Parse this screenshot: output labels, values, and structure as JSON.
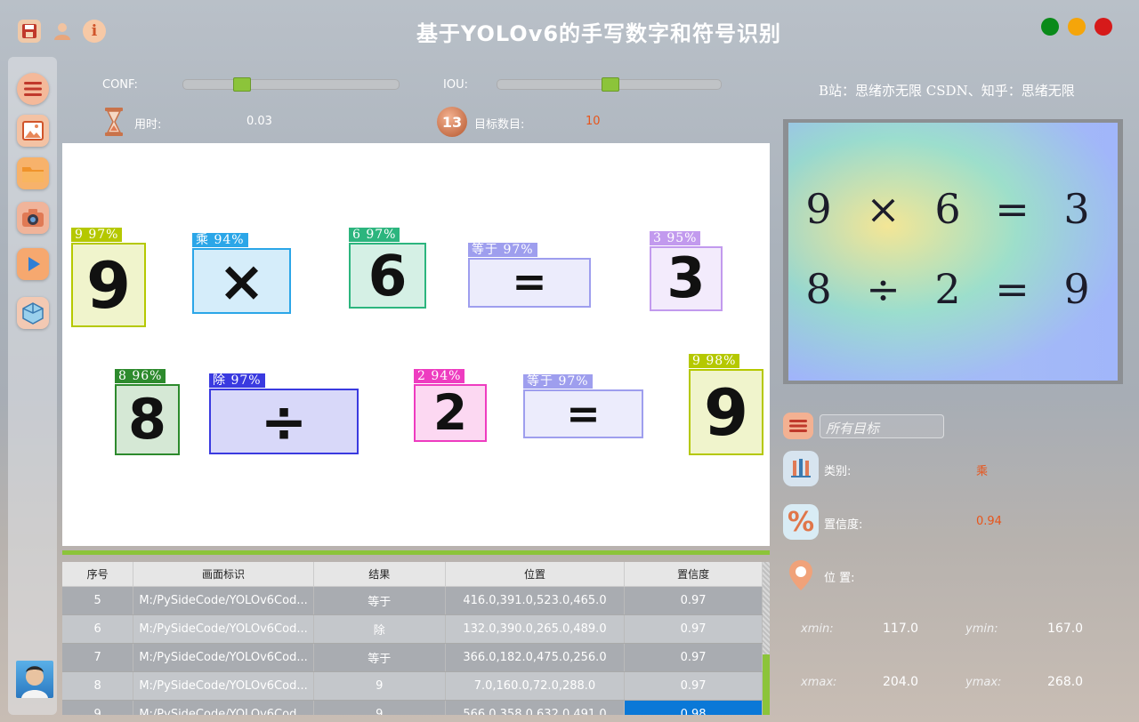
{
  "app": {
    "title": "基于YOLOv6的手写数字和符号识别"
  },
  "toolbar": {
    "icons": [
      "save-icon",
      "user-icon",
      "info-icon"
    ]
  },
  "window_controls": {
    "colors": [
      "#0a8a1a",
      "#f5a50a",
      "#d61a1a"
    ]
  },
  "sidebar": {
    "items": [
      "menu-icon",
      "image-icon",
      "folder-icon",
      "camera-icon",
      "video-icon",
      "model-icon"
    ]
  },
  "controls": {
    "conf_label": "CONF:",
    "conf_value": 0.25,
    "iou_label": "IOU:",
    "iou_value": 0.5,
    "time_label": "用时:",
    "time_value": "0.03",
    "count_label": "目标数目:",
    "count_value": "10",
    "count_badge": "13"
  },
  "credits": "B站：思绪亦无限  CSDN、知乎：思绪无限",
  "detections": [
    {
      "label": "9  97%",
      "glyph": "9",
      "color": "#b5c800"
    },
    {
      "label": "乘  94%",
      "glyph": "×",
      "color": "#2ba6e8"
    },
    {
      "label": "6  97%",
      "glyph": "6",
      "color": "#2cb57e"
    },
    {
      "label": "等于  97%",
      "glyph": "=",
      "color": "#9e9eee"
    },
    {
      "label": "3  95%",
      "glyph": "3",
      "color": "#c29aee"
    },
    {
      "label": "8  96%",
      "glyph": "8",
      "color": "#2d8a2d"
    },
    {
      "label": "除  97%",
      "glyph": "÷",
      "color": "#3a3ae0"
    },
    {
      "label": "2  94%",
      "glyph": "2",
      "color": "#ee3cc0"
    },
    {
      "label": "等于  97%",
      "glyph": "=",
      "color": "#9e9eee"
    },
    {
      "label": "9  98%",
      "glyph": "9",
      "color": "#b5c800"
    }
  ],
  "table": {
    "headers": [
      "序号",
      "画面标识",
      "结果",
      "位置",
      "置信度"
    ],
    "rows": [
      [
        "5",
        "M:/PySideCode/YOLOv6Cod...",
        "等于",
        "416.0,391.0,523.0,465.0",
        "0.97"
      ],
      [
        "6",
        "M:/PySideCode/YOLOv6Cod...",
        "除",
        "132.0,390.0,265.0,489.0",
        "0.97"
      ],
      [
        "7",
        "M:/PySideCode/YOLOv6Cod...",
        "等于",
        "366.0,182.0,475.0,256.0",
        "0.97"
      ],
      [
        "8",
        "M:/PySideCode/YOLOv6Cod...",
        "9",
        "7.0,160.0,72.0,288.0",
        "0.97"
      ],
      [
        "9",
        "M:/PySideCode/YOLOv6Cod...",
        "9",
        "566.0,358.0,632.0,491.0",
        "0.98"
      ]
    ]
  },
  "preview": {
    "line1": "9 × 6 = 3",
    "line2": "8 ÷ 2 = 9"
  },
  "target_select": {
    "placeholder": "所有目标"
  },
  "details": {
    "class_label": "类别:",
    "class_value": "乘",
    "conf_label": "置信度:",
    "conf_value": "0.94",
    "pos_label": "位 置:",
    "xmin_label": "xmin:",
    "xmin_value": "117.0",
    "ymin_label": "ymin:",
    "ymin_value": "167.0",
    "xmax_label": "xmax:",
    "xmax_value": "204.0",
    "ymax_label": "ymax:",
    "ymax_value": "268.0"
  }
}
